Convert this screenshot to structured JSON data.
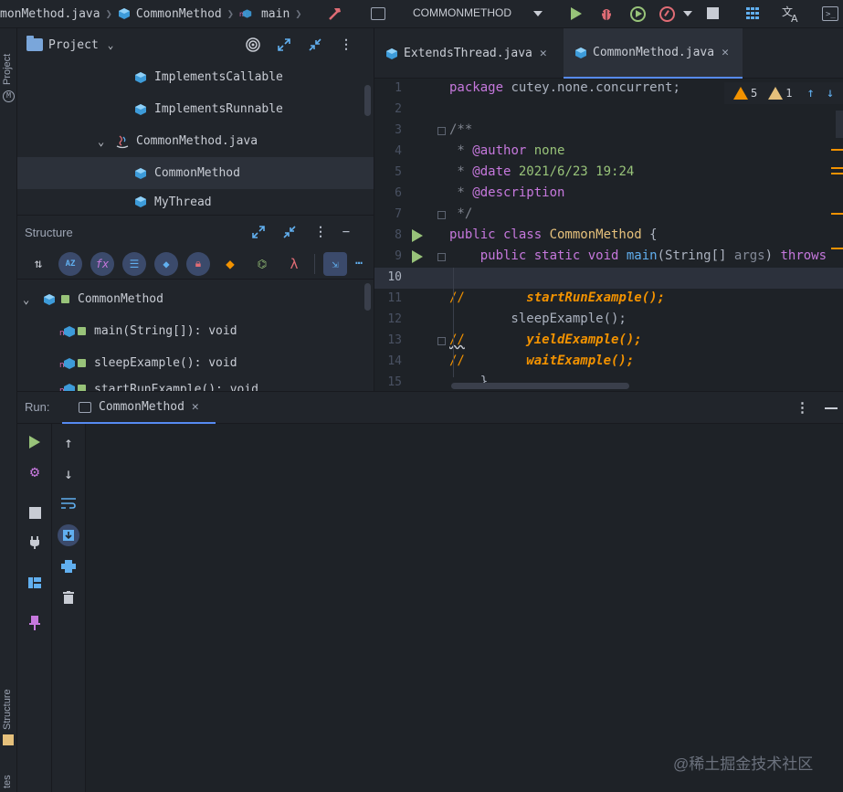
{
  "breadcrumb": {
    "file": "monMethod.java",
    "class": "CommonMethod",
    "method": "main"
  },
  "toolbar": {
    "run_config": "COMMONMETHOD"
  },
  "left_stripe": {
    "project_label": "Project",
    "structure_label": "Structure",
    "favorites_label": "tes"
  },
  "project_panel": {
    "title": "Project",
    "items": [
      {
        "label": "ImplementsCallable"
      },
      {
        "label": "ImplementsRunnable"
      },
      {
        "label": "CommonMethod.java"
      },
      {
        "label": "CommonMethod"
      },
      {
        "label": "MyThread"
      }
    ]
  },
  "structure_panel": {
    "title": "Structure",
    "root": "CommonMethod",
    "members": [
      {
        "label": "main(String[]): void"
      },
      {
        "label": "sleepExample(): void"
      },
      {
        "label": "startRunExample(): void"
      }
    ]
  },
  "editor": {
    "tabs": [
      {
        "label": "ExtendsThread.java"
      },
      {
        "label": "CommonMethod.java"
      }
    ],
    "warnings_count": "5",
    "weak_warnings_count": "1",
    "line_numbers": [
      "1",
      "2",
      "3",
      "4",
      "5",
      "6",
      "7",
      "8",
      "9",
      "10",
      "11",
      "12",
      "13",
      "14",
      "15"
    ],
    "code": {
      "l1_kw": "package",
      "l1_rest": " cutey.none.concurrent;",
      "l3": "/**",
      "l4_star": " * ",
      "l4_tag": "@author",
      "l4_val": " none",
      "l5_star": " * ",
      "l5_tag": "@date",
      "l5_val": " 2021/6/23 19:24",
      "l6_star": " * ",
      "l6_tag": "@description",
      "l7": " */",
      "l8_kw": "public class ",
      "l8_cls": "CommonMethod",
      "l8_rest": " {",
      "l9_kw": "    public static void ",
      "l9_fn": "main",
      "l9_args": "(String[] ",
      "l9_argname": "args",
      "l9_rest": ") ",
      "l9_throws": "throws",
      "l11_cm": "//",
      "l11_call": "        startRunExample();",
      "l12": "        sleepExample();",
      "l13_cm": "//",
      "l13_call": "        yieldExample();",
      "l14_cm": "//",
      "l14_call": "        waitExample();",
      "l15": "    }"
    }
  },
  "run_panel": {
    "label": "Run:",
    "tab": "CommonMethod"
  },
  "watermark": "@稀土掘金技术社区",
  "colors": {
    "accent": "#568af2",
    "run_green": "#98c379",
    "warning": "#f29200"
  }
}
